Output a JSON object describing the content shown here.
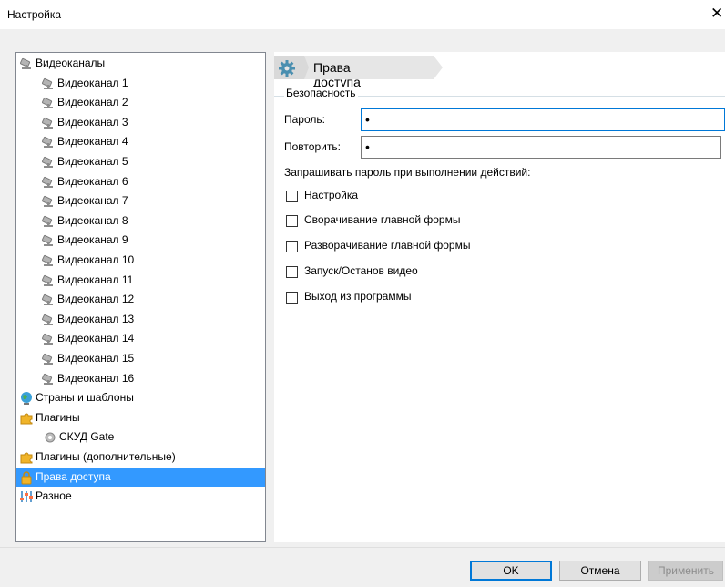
{
  "window": {
    "title": "Настройка",
    "close_glyph": "✕"
  },
  "tree": {
    "items": [
      {
        "label": "Видеоканалы",
        "icon": "camera-icon"
      },
      {
        "label": "Видеоканал 1",
        "icon": "camera-icon"
      },
      {
        "label": "Видеоканал 2",
        "icon": "camera-icon"
      },
      {
        "label": "Видеоканал 3",
        "icon": "camera-icon"
      },
      {
        "label": "Видеоканал 4",
        "icon": "camera-icon"
      },
      {
        "label": "Видеоканал 5",
        "icon": "camera-icon"
      },
      {
        "label": "Видеоканал 6",
        "icon": "camera-icon"
      },
      {
        "label": "Видеоканал 7",
        "icon": "camera-icon"
      },
      {
        "label": "Видеоканал 8",
        "icon": "camera-icon"
      },
      {
        "label": "Видеоканал 9",
        "icon": "camera-icon"
      },
      {
        "label": "Видеоканал 10",
        "icon": "camera-icon"
      },
      {
        "label": "Видеоканал 11",
        "icon": "camera-icon"
      },
      {
        "label": "Видеоканал 12",
        "icon": "camera-icon"
      },
      {
        "label": "Видеоканал 13",
        "icon": "camera-icon"
      },
      {
        "label": "Видеоканал 14",
        "icon": "camera-icon"
      },
      {
        "label": "Видеоканал 15",
        "icon": "camera-icon"
      },
      {
        "label": "Видеоканал 16",
        "icon": "camera-icon"
      },
      {
        "label": "Страны и шаблоны",
        "icon": "globe-icon"
      },
      {
        "label": "Плагины",
        "icon": "puzzle-icon"
      },
      {
        "label": "СКУД Gate",
        "icon": "plugin-gear-icon"
      },
      {
        "label": "Плагины (дополнительные)",
        "icon": "puzzle-icon"
      },
      {
        "label": "Права доступа",
        "icon": "lock-icon"
      },
      {
        "label": "Разное",
        "icon": "sliders-icon"
      }
    ],
    "selected_label": "Права доступа"
  },
  "panel": {
    "header_title": "Права доступа",
    "group_title": "Безопасность",
    "password_label": "Пароль:",
    "password_value": "•",
    "repeat_label": "Повторить:",
    "repeat_value": "•",
    "ask_label": "Запрашивать пароль при выполнении действий:",
    "checkboxes": [
      {
        "label": "Настройка",
        "checked": false
      },
      {
        "label": "Сворачивание главной формы",
        "checked": false
      },
      {
        "label": "Разворачивание главной формы",
        "checked": false
      },
      {
        "label": "Запуск/Останов видео",
        "checked": false
      },
      {
        "label": "Выход из программы",
        "checked": false
      }
    ]
  },
  "buttons": {
    "ok": "OK",
    "cancel": "Отмена",
    "apply": "Применить"
  },
  "colors": {
    "selection": "#3399ff",
    "accent": "#0078d7",
    "header_arrow": "#e6e6e6",
    "gear": "#4a8fb0"
  }
}
